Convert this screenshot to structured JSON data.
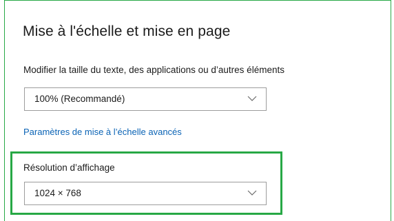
{
  "section": {
    "title": "Mise à l'échelle et mise en page",
    "scale_label": "Modifier la taille du texte, des applications ou d’autres éléments",
    "scale_value": "100% (Recommandé)",
    "advanced_link": "Paramètres de mise à l’échelle avancés",
    "resolution_label": "Résolution d’affichage",
    "resolution_value": "1024 × 768"
  },
  "icons": {
    "dropdown": "chevron-down-icon"
  },
  "colors": {
    "highlight": "#27a845",
    "link": "#0a63b5"
  }
}
